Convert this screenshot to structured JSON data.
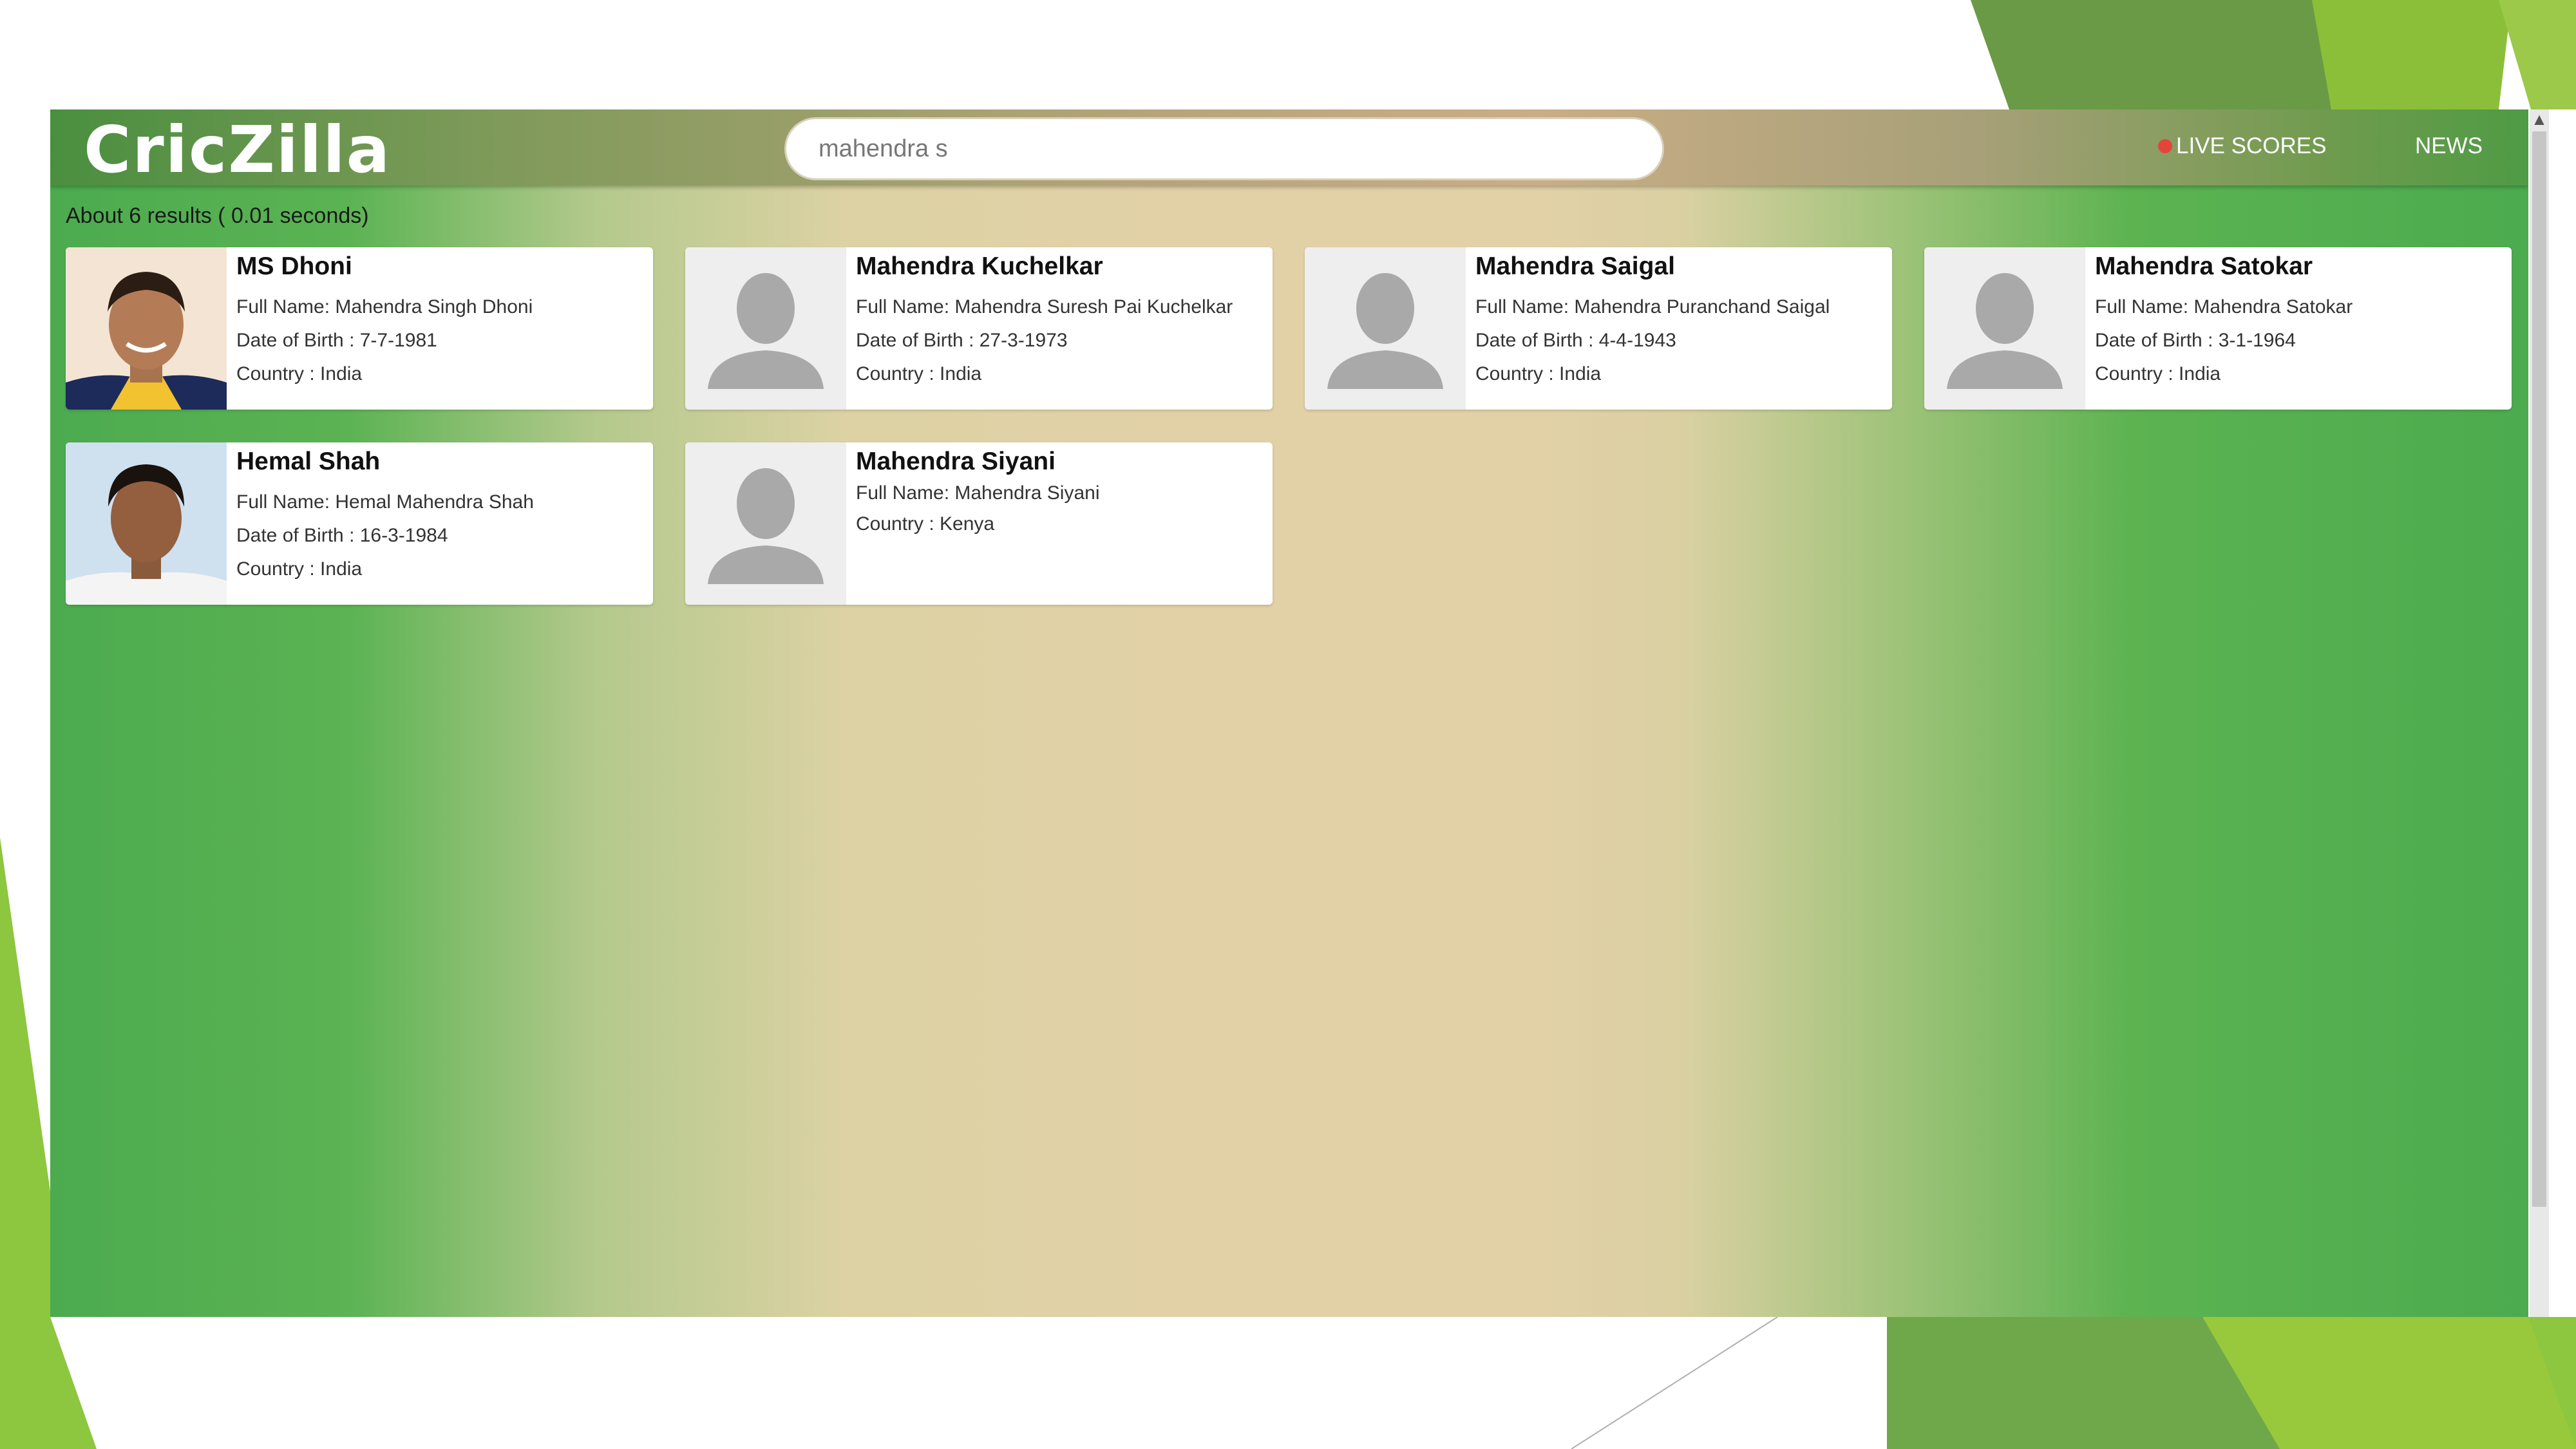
{
  "app": {
    "logo_text": "CricZilla"
  },
  "search": {
    "value": "mahendra s"
  },
  "nav": {
    "live_scores": "LIVE SCORES",
    "news": "NEWS"
  },
  "results": {
    "summary": "About 6 results ( 0.01 seconds)",
    "players": [
      {
        "name": "MS Dhoni",
        "full_name": "Full Name: Mahendra Singh Dhoni",
        "dob": "Date of Birth : 7-7-1981",
        "country": "Country : India",
        "photo": "player-photo"
      },
      {
        "name": "Mahendra Kuchelkar",
        "full_name": "Full Name: Mahendra Suresh Pai Kuchelkar",
        "dob": "Date of Birth : 27-3-1973",
        "country": "Country : India",
        "photo": "placeholder-avatar"
      },
      {
        "name": "Mahendra Saigal",
        "full_name": "Full Name: Mahendra Puranchand Saigal",
        "dob": "Date of Birth : 4-4-1943",
        "country": "Country : India",
        "photo": "placeholder-avatar"
      },
      {
        "name": "Mahendra Satokar",
        "full_name": "Full Name: Mahendra Satokar",
        "dob": "Date of Birth : 3-1-1964",
        "country": "Country : India",
        "photo": "placeholder-avatar"
      },
      {
        "name": "Hemal Shah",
        "full_name": "Full Name: Hemal Mahendra Shah",
        "dob": "Date of Birth : 16-3-1984",
        "country": "Country : India",
        "photo": "player-photo"
      },
      {
        "name": "Mahendra Siyani",
        "full_name": "Full Name: Mahendra Siyani",
        "country": "Country : Kenya",
        "photo": "placeholder-avatar"
      }
    ]
  },
  "colors": {
    "live_dot": "#e3453b",
    "page_green": "#4cab4f",
    "center_beige": "#e2d1a7",
    "slide_accent": "#8dc63f"
  }
}
